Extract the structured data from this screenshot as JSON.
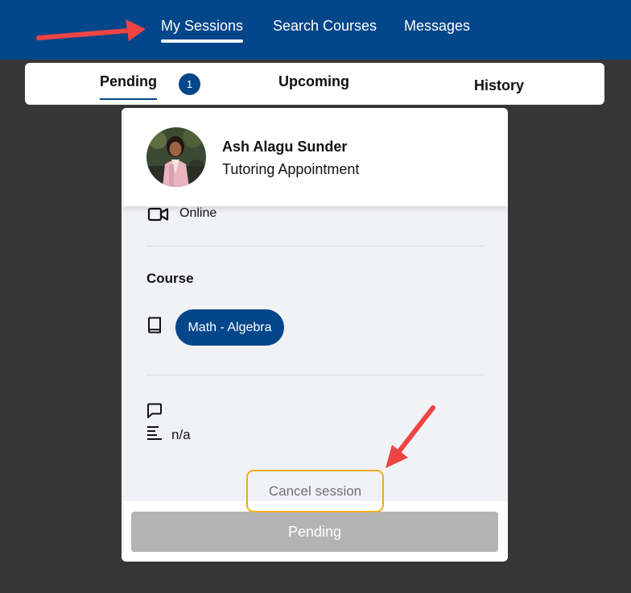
{
  "nav": {
    "items": [
      {
        "label": "My Sessions",
        "active": true
      },
      {
        "label": "Search Courses",
        "active": false
      },
      {
        "label": "Messages",
        "active": false
      }
    ]
  },
  "tabs": {
    "items": [
      {
        "label": "Pending",
        "active": true
      },
      {
        "label": "Upcoming",
        "active": false
      },
      {
        "label": "History",
        "active": false
      }
    ],
    "pending_badge": "1"
  },
  "session": {
    "tutor_name": "Ash Alagu Sunder",
    "appointment_type": "Tutoring Appointment",
    "mode": "Online",
    "course_heading": "Course",
    "course_name": "Math - Algebra",
    "notes": "n/a",
    "cancel_label": "Cancel session",
    "status_button_label": "Pending"
  },
  "colors": {
    "brand": "#03468a",
    "highlight": "#f0ad1c",
    "annotation_arrow": "#ef4444",
    "disabled_button": "#b3b3b3"
  },
  "icons": {
    "mode": "video-camera-icon",
    "course": "book-icon",
    "notes": "speech-bubble-icon",
    "description": "text-lines-icon",
    "annotations": "red-arrow-icon"
  }
}
